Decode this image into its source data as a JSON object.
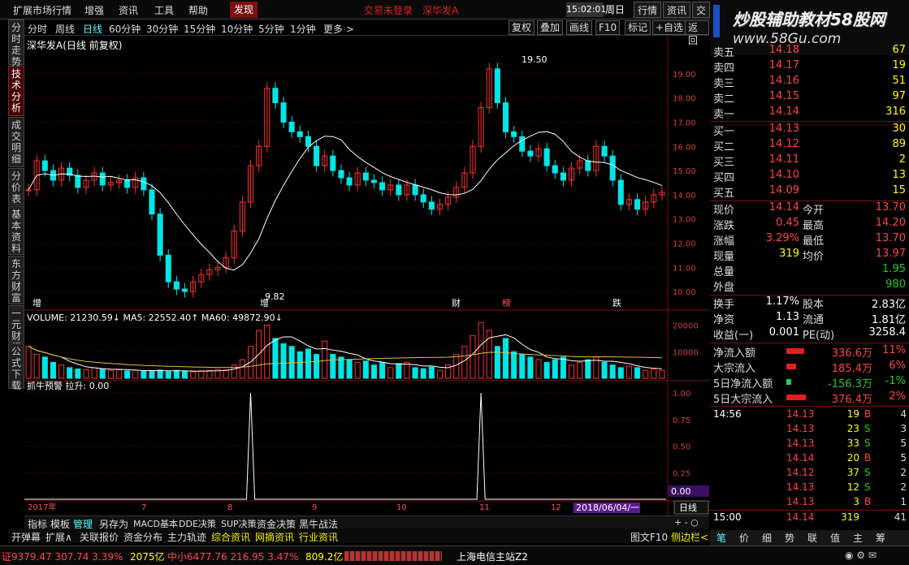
{
  "menubar": {
    "items": [
      "扩展市场行情",
      "增强",
      "资讯",
      "工具",
      "帮助"
    ],
    "highlight": "发现",
    "marquee_left": "交易未登录",
    "marquee_right": "深华发A",
    "clock": "15:02:01",
    "weekday": "周日",
    "right_buttons": [
      "行情",
      "资讯",
      "交易"
    ]
  },
  "watermark": {
    "line1": "炒股辅助教材58股网",
    "line2": "www.58Gu.com"
  },
  "side_tabs": [
    "分时走势",
    "技术分析",
    "成交明细",
    "分价表",
    "基本资料",
    "东方财富",
    "一元财经",
    "公式下载"
  ],
  "period_tabs": [
    "分时",
    "周线",
    "日线",
    "60分钟",
    "30分钟",
    "15分钟",
    "10分钟",
    "5分钟",
    "1分钟",
    "更多 >"
  ],
  "tools": [
    "复权",
    "叠加",
    "画线",
    "F10",
    "标记",
    "+自选",
    "返回"
  ],
  "chart_title": "深华发A(日线 前复权)",
  "annotations": {
    "high": "19.50",
    "low": "9.82",
    "event_tags": [
      "增",
      "财",
      "榜",
      "跌"
    ]
  },
  "volume_title": "VOLUME: 21230.59↓  MA5: 22552.40↑  MA60: 49872.90↓",
  "indicator_title": "抓牛预警  拉升: 0.00",
  "x_labels": [
    "2017年",
    "7",
    "8",
    "9",
    "10",
    "11",
    "12"
  ],
  "date_cursor": "2018/06/04/一",
  "right_axis_value": "0.00",
  "period_label": "日线",
  "colors": {
    "up": "#ff3030",
    "down": "#00e5e5",
    "ma": "#ffffff",
    "grid": "#5a0000"
  },
  "chart_data": [
    {
      "type": "line",
      "title": "深华发A(日线 前复权)",
      "ylim": [
        9.5,
        19.9
      ],
      "yticks": [
        10,
        11,
        12,
        13,
        14,
        15,
        16,
        17,
        18,
        19
      ],
      "series": [
        {
          "values": [
            14.2,
            15.4,
            15.0,
            14.6,
            15.1,
            14.8,
            14.3,
            14.6,
            14.9,
            14.4,
            14.5,
            14.6,
            14.3,
            14.7,
            14.2,
            13.2,
            11.5,
            10.4,
            10.1,
            10.0,
            10.4,
            10.7,
            10.9,
            11.0,
            11.4,
            12.5,
            13.7,
            15.2,
            16.0,
            18.4,
            17.8,
            17.0,
            16.6,
            16.4,
            16.0,
            15.2,
            15.6,
            15.0,
            14.7,
            14.4,
            14.9,
            14.6,
            14.5,
            14.2,
            14.4,
            14.0,
            14.4,
            14.0,
            13.7,
            13.4,
            13.6,
            13.9,
            14.3,
            14.9,
            16.0,
            17.6,
            19.2,
            17.8,
            16.6,
            16.4,
            15.8,
            15.6,
            15.9,
            15.2,
            14.9,
            14.6,
            15.1,
            15.4,
            15.0,
            16.0,
            15.6,
            14.6,
            13.6,
            13.8,
            13.4,
            13.7,
            14.0,
            14.1
          ]
        }
      ]
    },
    {
      "type": "bar",
      "title": "VOLUME: 21230.59↓  MA5: 22552.40↑  MA60: 49872.90↓",
      "ylim": [
        0,
        22000
      ],
      "yticks": [
        10000,
        20000
      ],
      "series": [
        {
          "name": "VOLUME",
          "values": [
            12000,
            9000,
            8000,
            6000,
            5000,
            4000,
            3500,
            3200,
            4000,
            3500,
            3000,
            3200,
            2800,
            3000,
            2600,
            2900,
            3100,
            2500,
            3000,
            2600,
            2400,
            2800,
            3000,
            3400,
            3200,
            5000,
            7000,
            12000,
            18000,
            20000,
            15000,
            13000,
            12000,
            10000,
            11000,
            9000,
            14000,
            9000,
            8000,
            7000,
            6000,
            6500,
            5000,
            6000,
            4000,
            5500,
            6000,
            4000,
            3600,
            4200,
            3000,
            5000,
            9000,
            12000,
            16000,
            21000,
            18000,
            12000,
            15000,
            10000,
            9000,
            8000,
            7000,
            6000,
            7000,
            8000,
            5000,
            6000,
            7000,
            8000,
            6000,
            5000,
            4000,
            4500,
            4000,
            3000,
            3500,
            3000
          ]
        },
        {
          "name": "MA5",
          "values": []
        },
        {
          "name": "MA60",
          "values": []
        }
      ]
    },
    {
      "type": "line",
      "title": "抓牛预警  拉升: 0.00",
      "ylim": [
        0,
        1
      ],
      "yticks": [
        0.25,
        0.5,
        0.75,
        1.0
      ],
      "series": [
        {
          "name": "拉升",
          "values": [
            0,
            0,
            0,
            0,
            0,
            0,
            0,
            0,
            0,
            0,
            0,
            0,
            0,
            0,
            0,
            0,
            0,
            0,
            0,
            0,
            0,
            0,
            0,
            0,
            0,
            0,
            0,
            1,
            0,
            0,
            0,
            0,
            0,
            0,
            0,
            0,
            0,
            0,
            0,
            0,
            0,
            0,
            0,
            0,
            0,
            0,
            0,
            0,
            0,
            0,
            0,
            0,
            0,
            0,
            0,
            1,
            0,
            0,
            0,
            0,
            0,
            0,
            0,
            0,
            0,
            0,
            0,
            0,
            0,
            0,
            0,
            0,
            0,
            0,
            0,
            0,
            0,
            0
          ]
        }
      ]
    }
  ],
  "orderbook": {
    "asks": [
      [
        "卖五",
        "14.18",
        "67"
      ],
      [
        "卖四",
        "14.17",
        "19"
      ],
      [
        "卖三",
        "14.16",
        "51"
      ],
      [
        "卖二",
        "14.15",
        "97"
      ],
      [
        "卖一",
        "14.14",
        "316"
      ]
    ],
    "bids": [
      [
        "买一",
        "14.13",
        "30"
      ],
      [
        "买二",
        "14.12",
        "89"
      ],
      [
        "买三",
        "14.11",
        "2"
      ],
      [
        "买四",
        "14.10",
        "13"
      ],
      [
        "买五",
        "14.09",
        "15"
      ]
    ]
  },
  "quote": [
    [
      "现价",
      "14.14",
      "今开",
      "13.70"
    ],
    [
      "涨跌",
      "0.45",
      "最高",
      "14.20"
    ],
    [
      "涨幅",
      "3.29%",
      "最低",
      "13.70"
    ],
    [
      "现量",
      "319",
      "均价",
      "13.97"
    ],
    [
      "总量",
      "",
      "",
      "1.95"
    ],
    [
      "外盘",
      "",
      "",
      "980"
    ]
  ],
  "fundamentals": [
    [
      "换手",
      "1.17%",
      "股本",
      "2.83亿"
    ],
    [
      "净资",
      "1.13",
      "流通",
      "1.81亿"
    ],
    [
      "收益(一)",
      "0.001",
      "PE(动)",
      "3258.4"
    ]
  ],
  "flows": [
    [
      "净流入额",
      "336.6万",
      "11%"
    ],
    [
      "大宗流入",
      "185.4万",
      "6%"
    ],
    [
      "5日净流入额",
      "-156.3万",
      "-1%"
    ],
    [
      "5日大宗流入",
      "376.4万",
      "2%"
    ]
  ],
  "ticks": [
    [
      "14:56",
      "14.13",
      "19",
      "B",
      "4"
    ],
    [
      "",
      "14.13",
      "23",
      "S",
      "3"
    ],
    [
      "",
      "14.13",
      "33",
      "S",
      "5"
    ],
    [
      "",
      "14.14",
      "20",
      "B",
      "5"
    ],
    [
      "",
      "14.12",
      "37",
      "S",
      "2"
    ],
    [
      "",
      "14.13",
      "12",
      "S",
      "2"
    ],
    [
      "",
      "14.13",
      "3",
      "B",
      "1"
    ],
    [
      "15:00",
      "14.14",
      "319",
      "",
      "41"
    ]
  ],
  "bottom_tabs": [
    "指标",
    "模板",
    "管理",
    "另存为",
    "MACD基本",
    "DDE决策",
    "SUP决策",
    "资金决策",
    "黑牛战法"
  ],
  "bottom_tabs2": [
    "开弹幕",
    "扩展∧",
    "关联报价",
    "资金分布",
    "主力轨迹",
    "综合资讯",
    "网摘资讯",
    "行业资讯",
    "图文F10",
    "侧边栏<"
  ],
  "right_tabs": [
    "笔",
    "价",
    "细",
    "势",
    "联",
    "值",
    "主",
    "筹"
  ],
  "status": {
    "idx1": "证9379.47  307.74  3.39%",
    "amt1": "2075亿",
    "idx2": "中小6477.76  216.95  3.47%",
    "amt2": "809.2亿",
    "server": "上海电信主站Z2"
  }
}
